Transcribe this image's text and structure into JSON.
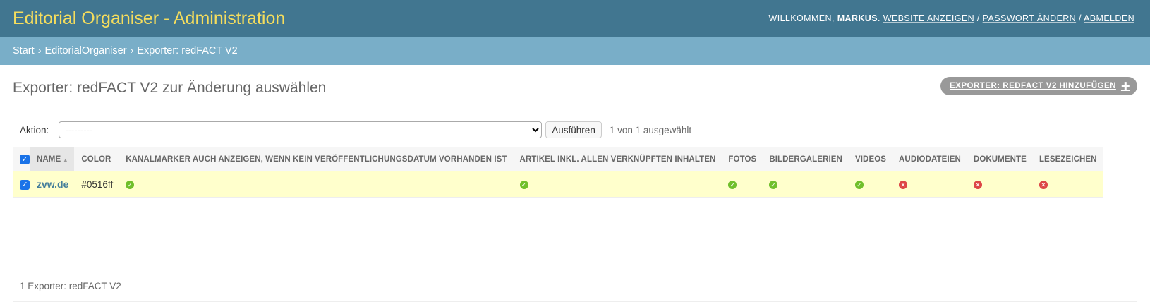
{
  "header": {
    "title": "Editorial Organiser - Administration",
    "welcome": "Willkommen,",
    "username": "Markus",
    "site_link": "Website anzeigen",
    "password_link": "Passwort ändern",
    "logout_link": "Abmelden",
    "sep": "/"
  },
  "breadcrumbs": [
    "Start",
    "EditorialOrganiser",
    "Exporter: redFACT V2"
  ],
  "breadcrumb_sep": "›",
  "page": {
    "title": "Exporter: redFACT V2 zur Änderung auswählen",
    "add_button": "Exporter: redFACT V2 hinzufügen"
  },
  "actions": {
    "label": "Aktion:",
    "selected_option": "---------",
    "run_button": "Ausführen",
    "counter": "1 von 1 ausgewählt"
  },
  "table": {
    "columns": [
      "Name",
      "Color",
      "Kanalmarker auch anzeigen, wenn kein Veröffentlichungsdatum vorhanden ist",
      "Artikel inkl. allen verknüpften Inhalten",
      "Fotos",
      "Bildergalerien",
      "Videos",
      "Audiodateien",
      "Dokumente",
      "Lesezeichen"
    ],
    "rows": [
      {
        "name": "zvw.de",
        "color": "#0516ff",
        "kanalmarker": true,
        "artikel": true,
        "fotos": true,
        "bildergalerien": true,
        "videos": true,
        "audiodateien": false,
        "dokumente": false,
        "lesezeichen": false
      }
    ]
  },
  "paginator": "1 Exporter: redFACT V2",
  "colors": {
    "header_bg": "#417690",
    "breadcrumbs_bg": "#79aec8",
    "branding": "#f5dd5d",
    "selected_row": "#ffffcc",
    "yes": "#70bf2b",
    "no": "#dd4646"
  }
}
